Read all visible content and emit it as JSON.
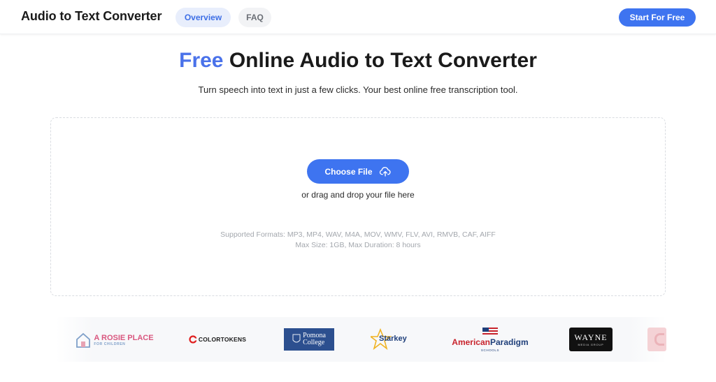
{
  "header": {
    "brand": "Audio to Text Converter",
    "nav": [
      "Overview",
      "FAQ"
    ],
    "cta": "Start For Free"
  },
  "hero": {
    "title_accent": "Free",
    "title_rest": "Online Audio to Text Converter",
    "subtitle": "Turn speech into text in just a few clicks. Your best online free transcription tool."
  },
  "upload": {
    "button_label": "Choose File",
    "button_icon": "cloud-upload-icon",
    "drag_text": "or drag and drop your file here",
    "formats": "Supported Formats: MP3, MP4, WAV, M4A, MOV, WMV, FLV, AVI, RMVB, CAF, AIFF",
    "limits": "Max Size: 1GB, Max Duration: 8 hours"
  },
  "logos": {
    "rosie_main": "A ROSIE PLACE",
    "rosie_sub": "FOR CHILDREN",
    "colortokens": "COLORTOKENS",
    "pomona_1": "Pomona",
    "pomona_2": "College",
    "starkey": "Starkey",
    "ap_main_1": "American",
    "ap_main_2": "Paradigm",
    "ap_sub": "SCHOOLS",
    "wayne_main": "WAYNE",
    "wayne_sub": "MEDIA GROUP"
  },
  "colors": {
    "accent": "#3e74f0",
    "title_accent": "#4a72ea"
  }
}
